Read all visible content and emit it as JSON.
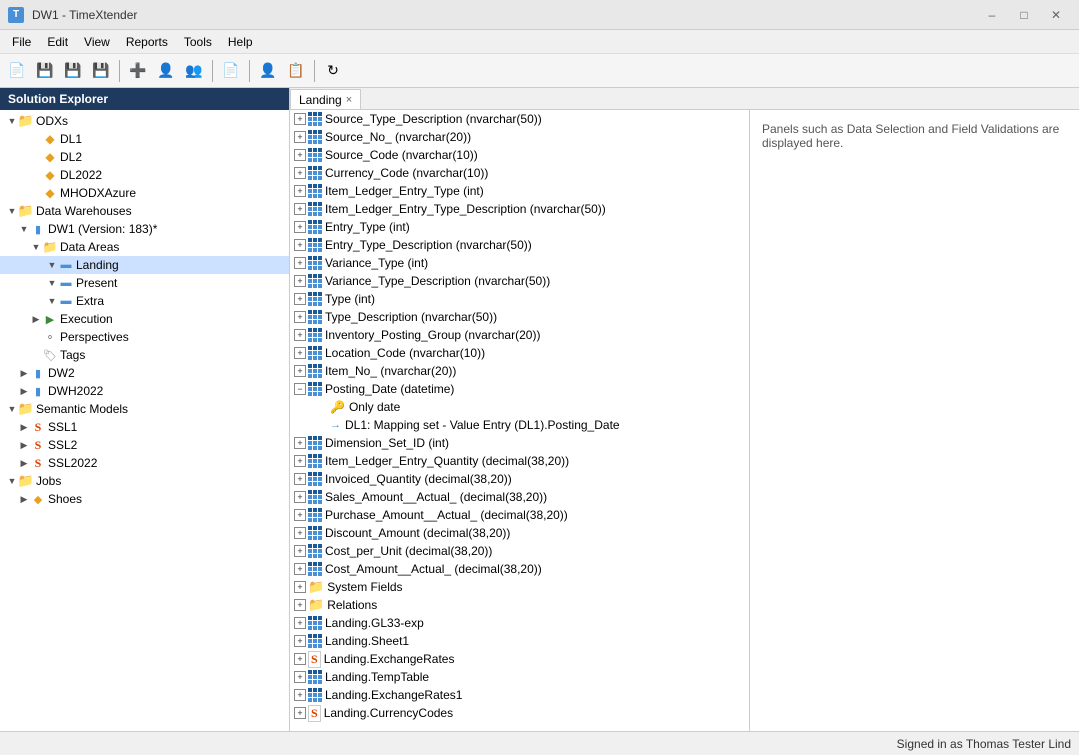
{
  "window": {
    "title": "DW1 - TimeXtender",
    "icon": "TX"
  },
  "menu": {
    "items": [
      "File",
      "Edit",
      "View",
      "Reports",
      "Tools",
      "Help"
    ]
  },
  "solution_explorer": {
    "title": "Solution Explorer",
    "tree": {
      "odxs": {
        "label": "ODXs",
        "children": [
          "DL1",
          "DL2",
          "DL2022",
          "MHODXAzure"
        ]
      },
      "data_warehouses": {
        "label": "Data Warehouses",
        "dw1": {
          "label": "DW1 (Version: 183)*",
          "data_areas_label": "Data Areas",
          "landing": "Landing",
          "present": "Present",
          "extra": "Extra",
          "execution": "Execution",
          "perspectives": "Perspectives",
          "tags": "Tags"
        },
        "dw2": "DW2",
        "dwh2022": "DWH2022"
      },
      "semantic_models": {
        "label": "Semantic Models",
        "children": [
          "SSL1",
          "SSL2",
          "SSL2022"
        ]
      },
      "jobs": {
        "label": "Jobs",
        "children": [
          "Shoes"
        ]
      }
    }
  },
  "tab": {
    "label": "Landing",
    "close": "×"
  },
  "fields": [
    {
      "label": "Source_Type_Description (nvarchar(50))",
      "expanded": true
    },
    {
      "label": "Source_No_ (nvarchar(20))",
      "expanded": true
    },
    {
      "label": "Source_Code (nvarchar(10))",
      "expanded": true
    },
    {
      "label": "Currency_Code (nvarchar(10))",
      "expanded": true
    },
    {
      "label": "Item_Ledger_Entry_Type (int)",
      "expanded": true
    },
    {
      "label": "Item_Ledger_Entry_Type_Description (nvarchar(50))",
      "expanded": true
    },
    {
      "label": "Entry_Type (int)",
      "expanded": true
    },
    {
      "label": "Entry_Type_Description (nvarchar(50))",
      "expanded": true
    },
    {
      "label": "Variance_Type (int)",
      "expanded": true
    },
    {
      "label": "Variance_Type_Description (nvarchar(50))",
      "expanded": true
    },
    {
      "label": "Type (int)",
      "expanded": true
    },
    {
      "label": "Type_Description (nvarchar(50))",
      "expanded": true
    },
    {
      "label": "Inventory_Posting_Group (nvarchar(20))",
      "expanded": true
    },
    {
      "label": "Location_Code (nvarchar(10))",
      "expanded": true
    },
    {
      "label": "Item_No_ (nvarchar(20))",
      "expanded": true
    },
    {
      "label": "Posting_Date (datetime)",
      "expanded": false,
      "has_children": true,
      "children": [
        {
          "type": "only_date",
          "label": "Only date"
        },
        {
          "type": "mapping",
          "label": "DL1: Mapping set - Value Entry (DL1).Posting_Date"
        }
      ]
    },
    {
      "label": "Dimension_Set_ID (int)",
      "expanded": true
    },
    {
      "label": "Item_Ledger_Entry_Quantity (decimal(38,20))",
      "expanded": true
    },
    {
      "label": "Invoiced_Quantity (decimal(38,20))",
      "expanded": true
    },
    {
      "label": "Sales_Amount__Actual_ (decimal(38,20))",
      "expanded": true
    },
    {
      "label": "Purchase_Amount__Actual_ (decimal(38,20))",
      "expanded": true
    },
    {
      "label": "Discount_Amount (decimal(38,20))",
      "expanded": true
    },
    {
      "label": "Cost_per_Unit (decimal(38,20))",
      "expanded": true
    },
    {
      "label": "Cost_Amount__Actual_ (decimal(38,20))",
      "expanded": true
    },
    {
      "label": "System Fields",
      "type": "folder"
    },
    {
      "label": "Relations",
      "type": "folder"
    }
  ],
  "other_tables": [
    {
      "label": "Landing.GL33-exp"
    },
    {
      "label": "Landing.Sheet1"
    },
    {
      "label": "Landing.ExchangeRates",
      "has_s": true
    },
    {
      "label": "Landing.TempTable"
    },
    {
      "label": "Landing.ExchangeRates1"
    },
    {
      "label": "Landing.CurrencyCodes",
      "has_s": true
    }
  ],
  "info_panel": {
    "text": "Panels such as Data Selection and Field Validations are displayed here."
  },
  "status_bar": {
    "text": "Signed in as Thomas Tester Lind"
  }
}
